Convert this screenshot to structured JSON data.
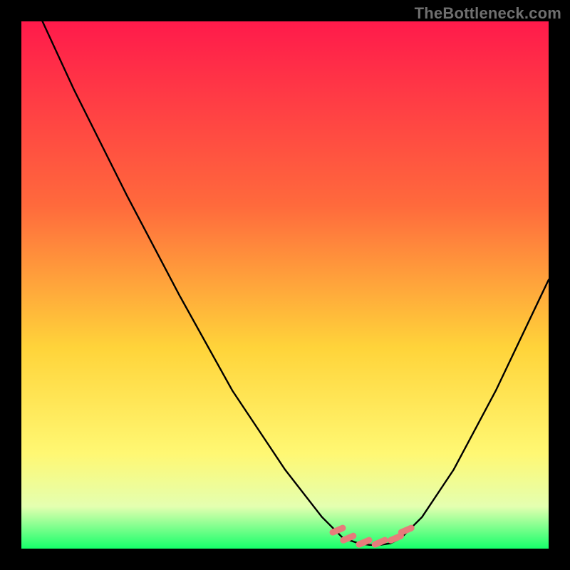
{
  "watermark": "TheBottleneck.com",
  "colors": {
    "bg": "#000000",
    "curve": "#000000",
    "marker": "#e77b7b",
    "grad_top": "#ff1a4b",
    "grad_mid1": "#ff6a3c",
    "grad_mid2": "#ffd43a",
    "grad_mid3": "#fff873",
    "grad_mid4": "#e4ffb0",
    "grad_bottom": "#16ff6a"
  },
  "chart_data": {
    "type": "line",
    "title": "",
    "xlabel": "",
    "ylabel": "",
    "xlim": [
      0,
      100
    ],
    "ylim": [
      0,
      100
    ],
    "optimum_x_range": [
      61,
      72
    ],
    "curve": [
      {
        "x": 4,
        "y": 100
      },
      {
        "x": 10,
        "y": 87
      },
      {
        "x": 20,
        "y": 67
      },
      {
        "x": 30,
        "y": 48
      },
      {
        "x": 40,
        "y": 30
      },
      {
        "x": 50,
        "y": 15
      },
      {
        "x": 57,
        "y": 6
      },
      {
        "x": 61,
        "y": 2
      },
      {
        "x": 64,
        "y": 1
      },
      {
        "x": 66,
        "y": 0.7
      },
      {
        "x": 68,
        "y": 0.7
      },
      {
        "x": 70,
        "y": 1
      },
      {
        "x": 72,
        "y": 2
      },
      {
        "x": 76,
        "y": 6
      },
      {
        "x": 82,
        "y": 15
      },
      {
        "x": 90,
        "y": 30
      },
      {
        "x": 100,
        "y": 51
      }
    ],
    "markers": [
      {
        "x": 60,
        "y": 3.5
      },
      {
        "x": 62,
        "y": 2.0
      },
      {
        "x": 65,
        "y": 1.2
      },
      {
        "x": 68,
        "y": 1.2
      },
      {
        "x": 71,
        "y": 2.0
      },
      {
        "x": 73,
        "y": 3.5
      }
    ]
  }
}
